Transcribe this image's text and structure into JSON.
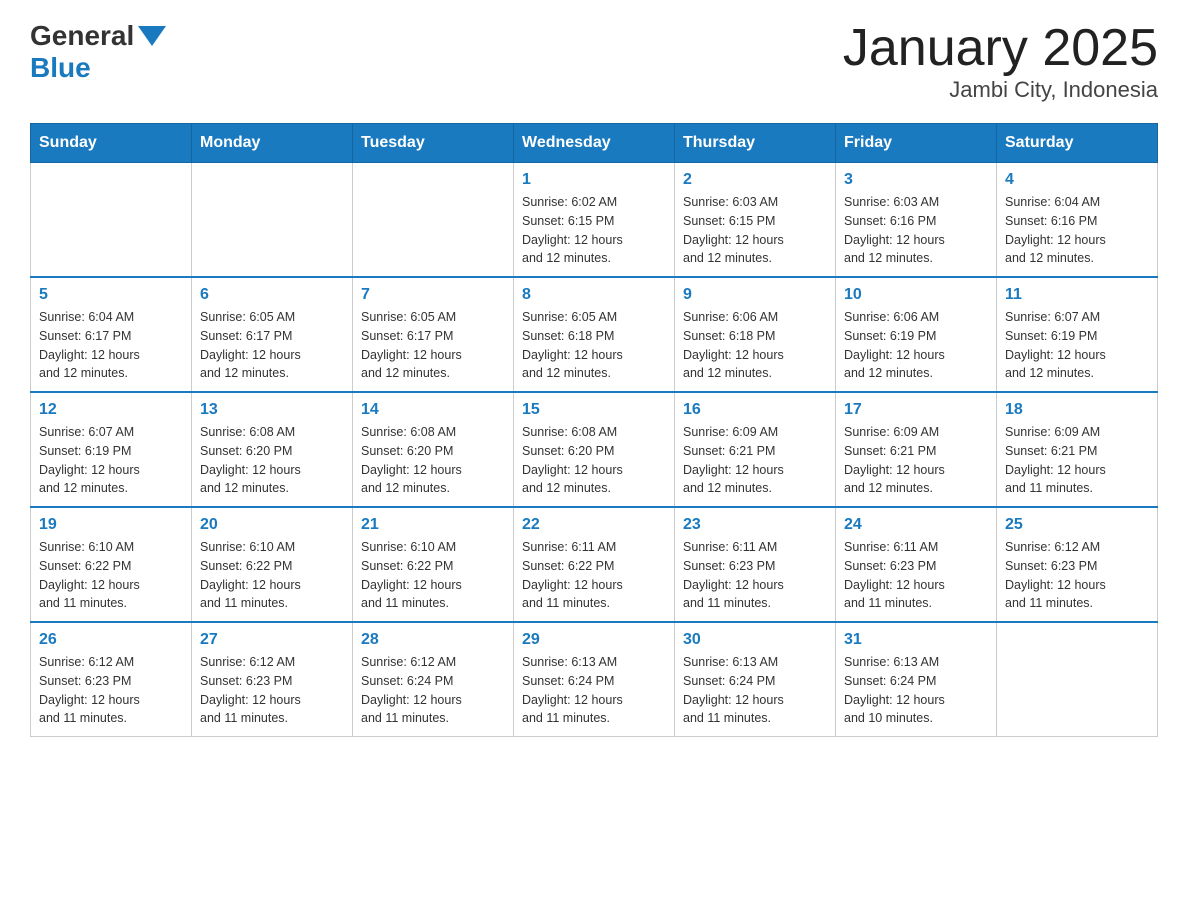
{
  "header": {
    "logo_general": "General",
    "logo_blue": "Blue",
    "month_title": "January 2025",
    "location": "Jambi City, Indonesia"
  },
  "weekdays": [
    "Sunday",
    "Monday",
    "Tuesday",
    "Wednesday",
    "Thursday",
    "Friday",
    "Saturday"
  ],
  "weeks": [
    {
      "days": [
        {
          "number": "",
          "info": ""
        },
        {
          "number": "",
          "info": ""
        },
        {
          "number": "",
          "info": ""
        },
        {
          "number": "1",
          "info": "Sunrise: 6:02 AM\nSunset: 6:15 PM\nDaylight: 12 hours\nand 12 minutes."
        },
        {
          "number": "2",
          "info": "Sunrise: 6:03 AM\nSunset: 6:15 PM\nDaylight: 12 hours\nand 12 minutes."
        },
        {
          "number": "3",
          "info": "Sunrise: 6:03 AM\nSunset: 6:16 PM\nDaylight: 12 hours\nand 12 minutes."
        },
        {
          "number": "4",
          "info": "Sunrise: 6:04 AM\nSunset: 6:16 PM\nDaylight: 12 hours\nand 12 minutes."
        }
      ]
    },
    {
      "days": [
        {
          "number": "5",
          "info": "Sunrise: 6:04 AM\nSunset: 6:17 PM\nDaylight: 12 hours\nand 12 minutes."
        },
        {
          "number": "6",
          "info": "Sunrise: 6:05 AM\nSunset: 6:17 PM\nDaylight: 12 hours\nand 12 minutes."
        },
        {
          "number": "7",
          "info": "Sunrise: 6:05 AM\nSunset: 6:17 PM\nDaylight: 12 hours\nand 12 minutes."
        },
        {
          "number": "8",
          "info": "Sunrise: 6:05 AM\nSunset: 6:18 PM\nDaylight: 12 hours\nand 12 minutes."
        },
        {
          "number": "9",
          "info": "Sunrise: 6:06 AM\nSunset: 6:18 PM\nDaylight: 12 hours\nand 12 minutes."
        },
        {
          "number": "10",
          "info": "Sunrise: 6:06 AM\nSunset: 6:19 PM\nDaylight: 12 hours\nand 12 minutes."
        },
        {
          "number": "11",
          "info": "Sunrise: 6:07 AM\nSunset: 6:19 PM\nDaylight: 12 hours\nand 12 minutes."
        }
      ]
    },
    {
      "days": [
        {
          "number": "12",
          "info": "Sunrise: 6:07 AM\nSunset: 6:19 PM\nDaylight: 12 hours\nand 12 minutes."
        },
        {
          "number": "13",
          "info": "Sunrise: 6:08 AM\nSunset: 6:20 PM\nDaylight: 12 hours\nand 12 minutes."
        },
        {
          "number": "14",
          "info": "Sunrise: 6:08 AM\nSunset: 6:20 PM\nDaylight: 12 hours\nand 12 minutes."
        },
        {
          "number": "15",
          "info": "Sunrise: 6:08 AM\nSunset: 6:20 PM\nDaylight: 12 hours\nand 12 minutes."
        },
        {
          "number": "16",
          "info": "Sunrise: 6:09 AM\nSunset: 6:21 PM\nDaylight: 12 hours\nand 12 minutes."
        },
        {
          "number": "17",
          "info": "Sunrise: 6:09 AM\nSunset: 6:21 PM\nDaylight: 12 hours\nand 12 minutes."
        },
        {
          "number": "18",
          "info": "Sunrise: 6:09 AM\nSunset: 6:21 PM\nDaylight: 12 hours\nand 11 minutes."
        }
      ]
    },
    {
      "days": [
        {
          "number": "19",
          "info": "Sunrise: 6:10 AM\nSunset: 6:22 PM\nDaylight: 12 hours\nand 11 minutes."
        },
        {
          "number": "20",
          "info": "Sunrise: 6:10 AM\nSunset: 6:22 PM\nDaylight: 12 hours\nand 11 minutes."
        },
        {
          "number": "21",
          "info": "Sunrise: 6:10 AM\nSunset: 6:22 PM\nDaylight: 12 hours\nand 11 minutes."
        },
        {
          "number": "22",
          "info": "Sunrise: 6:11 AM\nSunset: 6:22 PM\nDaylight: 12 hours\nand 11 minutes."
        },
        {
          "number": "23",
          "info": "Sunrise: 6:11 AM\nSunset: 6:23 PM\nDaylight: 12 hours\nand 11 minutes."
        },
        {
          "number": "24",
          "info": "Sunrise: 6:11 AM\nSunset: 6:23 PM\nDaylight: 12 hours\nand 11 minutes."
        },
        {
          "number": "25",
          "info": "Sunrise: 6:12 AM\nSunset: 6:23 PM\nDaylight: 12 hours\nand 11 minutes."
        }
      ]
    },
    {
      "days": [
        {
          "number": "26",
          "info": "Sunrise: 6:12 AM\nSunset: 6:23 PM\nDaylight: 12 hours\nand 11 minutes."
        },
        {
          "number": "27",
          "info": "Sunrise: 6:12 AM\nSunset: 6:23 PM\nDaylight: 12 hours\nand 11 minutes."
        },
        {
          "number": "28",
          "info": "Sunrise: 6:12 AM\nSunset: 6:24 PM\nDaylight: 12 hours\nand 11 minutes."
        },
        {
          "number": "29",
          "info": "Sunrise: 6:13 AM\nSunset: 6:24 PM\nDaylight: 12 hours\nand 11 minutes."
        },
        {
          "number": "30",
          "info": "Sunrise: 6:13 AM\nSunset: 6:24 PM\nDaylight: 12 hours\nand 11 minutes."
        },
        {
          "number": "31",
          "info": "Sunrise: 6:13 AM\nSunset: 6:24 PM\nDaylight: 12 hours\nand 10 minutes."
        },
        {
          "number": "",
          "info": ""
        }
      ]
    }
  ]
}
